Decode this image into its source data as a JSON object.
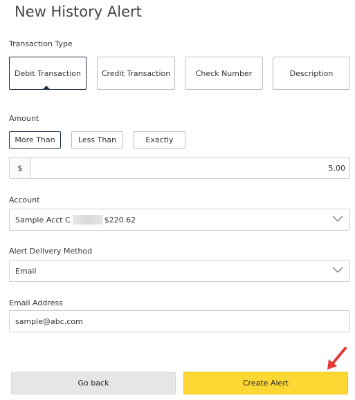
{
  "page": {
    "title": "New History Alert"
  },
  "transaction_type": {
    "label": "Transaction Type",
    "options": [
      "Debit Transaction",
      "Credit Transaction",
      "Check Number",
      "Description"
    ],
    "selected": "Debit Transaction"
  },
  "amount": {
    "label": "Amount",
    "options": [
      "More Than",
      "Less Than",
      "Exactly"
    ],
    "selected": "More Than",
    "currency_symbol": "$",
    "value": "5.00"
  },
  "account": {
    "label": "Account",
    "value_prefix": "Sample Acct C",
    "value_amount": "$220.62"
  },
  "delivery": {
    "label": "Alert Delivery Method",
    "value": "Email"
  },
  "email": {
    "label": "Email Address",
    "value": "sample@abc.com"
  },
  "actions": {
    "back_label": "Go back",
    "create_label": "Create Alert"
  },
  "colors": {
    "accent_dark": "#1f2f45",
    "primary_button": "#fdd835",
    "annotation_arrow": "#e53935"
  },
  "icons": {
    "select_chevron": "chevron-down-icon",
    "annotation": "pointer-arrow-icon"
  }
}
